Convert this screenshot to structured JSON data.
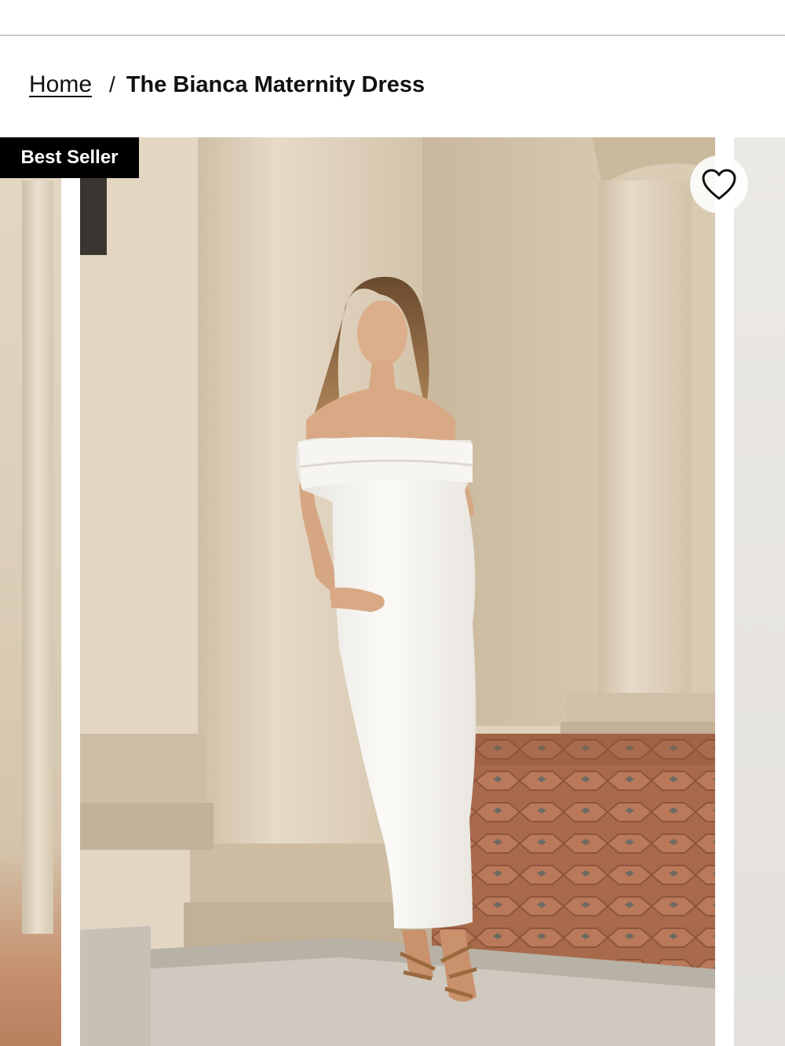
{
  "breadcrumb": {
    "home_label": "Home",
    "separator": "/",
    "current_label": "The Bianca Maternity Dress"
  },
  "gallery": {
    "badge_label": "Best Seller",
    "wishlist_icon": "heart-icon",
    "colors": {
      "badge_bg": "#000000",
      "badge_text": "#ffffff",
      "wall": "#d9cab3",
      "dress": "#f5f3ee",
      "floor": "#a86a4c"
    }
  }
}
